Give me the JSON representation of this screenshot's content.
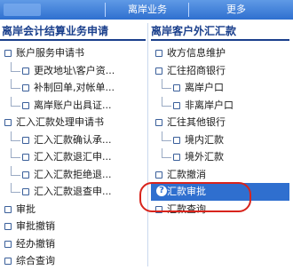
{
  "header": {
    "tabs": [
      {
        "label": "离岸业务"
      },
      {
        "label": "更多"
      }
    ]
  },
  "left_panel": {
    "title": "离岸会计结算业务申请",
    "items": [
      {
        "label": "账户服务申请书",
        "level": 1
      },
      {
        "label": "更改地址\\客户资...",
        "level": 2
      },
      {
        "label": "补制回单,对帐单...",
        "level": 2
      },
      {
        "label": "离岸账户出具证...",
        "level": 2
      },
      {
        "label": "汇入汇款处理申请书",
        "level": 1
      },
      {
        "label": "汇入汇款确认承...",
        "level": 2
      },
      {
        "label": "汇入汇款退汇申...",
        "level": 2
      },
      {
        "label": "汇入汇款拒绝退...",
        "level": 2
      },
      {
        "label": "汇入汇款退查申...",
        "level": 2
      },
      {
        "label": "审批",
        "level": 1
      },
      {
        "label": "审批撤销",
        "level": 1
      },
      {
        "label": "经办撤销",
        "level": 1
      },
      {
        "label": "综合查询",
        "level": 1
      }
    ]
  },
  "right_panel": {
    "title": "离岸客户外汇汇款",
    "items": [
      {
        "label": "收方信息维护",
        "level": 1
      },
      {
        "label": "汇往招商银行",
        "level": 1
      },
      {
        "label": "离岸户口",
        "level": 2
      },
      {
        "label": "非离岸户口",
        "level": 2
      },
      {
        "label": "汇往其他银行",
        "level": 1
      },
      {
        "label": "境内汇款",
        "level": 2
      },
      {
        "label": "境外汇款",
        "level": 2
      },
      {
        "label": "汇款撤消",
        "level": 1
      },
      {
        "label": "汇款审批",
        "level": 1,
        "selected": true
      },
      {
        "label": "汇款查询",
        "level": 1
      }
    ]
  },
  "colors": {
    "header": "#2f6fcf",
    "title": "#1a3f8c",
    "highlight": "#2f6fcf",
    "annotation": "#d8241c"
  },
  "icons": {
    "bullet": "square-bullet-icon",
    "selected": "help-circle-icon"
  }
}
